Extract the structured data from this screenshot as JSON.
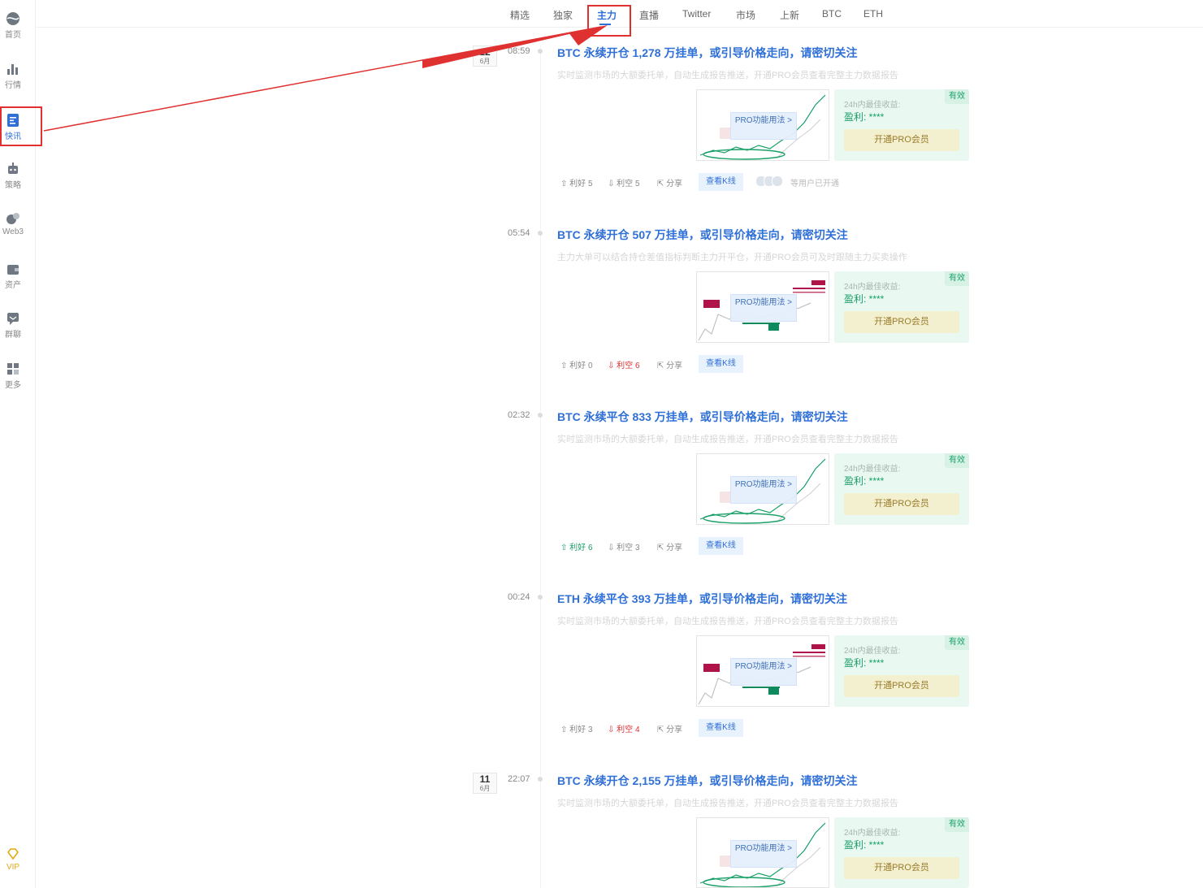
{
  "sidebar": {
    "items": [
      {
        "label": "首页",
        "icon": "globe-icon"
      },
      {
        "label": "行情",
        "icon": "bar-chart-icon"
      },
      {
        "label": "快讯",
        "icon": "news-icon"
      },
      {
        "label": "策略",
        "icon": "robot-icon"
      },
      {
        "label": "Web3",
        "icon": "web3-icon"
      },
      {
        "label": "资产",
        "icon": "wallet-icon"
      },
      {
        "label": "群聊",
        "icon": "chat-icon"
      },
      {
        "label": "更多",
        "icon": "grid-icon"
      }
    ],
    "vip_label": "VIP"
  },
  "tabs": [
    "精选",
    "独家",
    "主力",
    "直播",
    "Twitter",
    "市场",
    "上新",
    "BTC",
    "ETH"
  ],
  "active_tab": "主力",
  "feed": [
    {
      "date_day": "12",
      "date_month": "6月",
      "time": "08:59",
      "title": "BTC 永续开仓 1,278 万挂单，或引导价格走向，请密切关注",
      "subtitle": "实时监测市场的大额委托单，自动生成报告推送，开通PRO会员查看完整主力数据报告",
      "pro_label": "PRO功能用法 >",
      "chart_style": "trend",
      "card": {
        "badge": "有效",
        "label": "24h内最佳收益:",
        "value": "盈利: ****",
        "button": "开通PRO会员"
      },
      "bullish": "利好 5",
      "bearish": "利空 5",
      "share": "分享",
      "kline": "查看K线",
      "opened": "等用户已开通"
    },
    {
      "time": "05:54",
      "title": "BTC 永续开仓 507 万挂单，或引导价格走向，请密切关注",
      "subtitle": "主力大单可以结合持仓差值指标判断主力开平仓，开通PRO会员可及时跟随主力买卖操作",
      "pro_label": "PRO功能用法 >",
      "chart_style": "orders",
      "card": {
        "badge": "有效",
        "label": "24h内最佳收益:",
        "value": "盈利: ****",
        "button": "开通PRO会员"
      },
      "bullish": "利好 0",
      "bearish": "利空 6",
      "share": "分享",
      "kline": "查看K线"
    },
    {
      "time": "02:32",
      "title": "BTC 永续平仓 833 万挂单，或引导价格走向，请密切关注",
      "subtitle": "实时监测市场的大额委托单，自动生成报告推送，开通PRO会员查看完整主力数据报告",
      "pro_label": "PRO功能用法 >",
      "chart_style": "trend",
      "card": {
        "badge": "有效",
        "label": "24h内最佳收益:",
        "value": "盈利: ****",
        "button": "开通PRO会员"
      },
      "bullish": "利好 6",
      "bearish": "利空 3",
      "share": "分享",
      "kline": "查看K线"
    },
    {
      "time": "00:24",
      "title": "ETH 永续平仓 393 万挂单，或引导价格走向，请密切关注",
      "subtitle": "实时监测市场的大额委托单，自动生成报告推送，开通PRO会员查看完整主力数据报告",
      "pro_label": "PRO功能用法 >",
      "chart_style": "orders",
      "card": {
        "badge": "有效",
        "label": "24h内最佳收益:",
        "value": "盈利: ****",
        "button": "开通PRO会员"
      },
      "bullish": "利好 3",
      "bearish": "利空 4",
      "share": "分享",
      "kline": "查看K线"
    },
    {
      "date_day": "11",
      "date_month": "6月",
      "time": "22:07",
      "title": "BTC 永续开仓 2,155 万挂单，或引导价格走向，请密切关注",
      "subtitle": "实时监测市场的大额委托单，自动生成报告推送，开通PRO会员查看完整主力数据报告",
      "pro_label": "PRO功能用法 >",
      "chart_style": "trend",
      "card": {
        "badge": "有效",
        "label": "24h内最佳收益:",
        "value": "盈利: ****",
        "button": "开通PRO会员"
      }
    }
  ],
  "colors": {
    "accent": "#2f6fd8",
    "highlight": "#e03131",
    "bullish": "#1aa068",
    "bearish": "#e03131",
    "card_bg": "#e9f8f1",
    "pro_button_bg": "#f3f0cf"
  }
}
